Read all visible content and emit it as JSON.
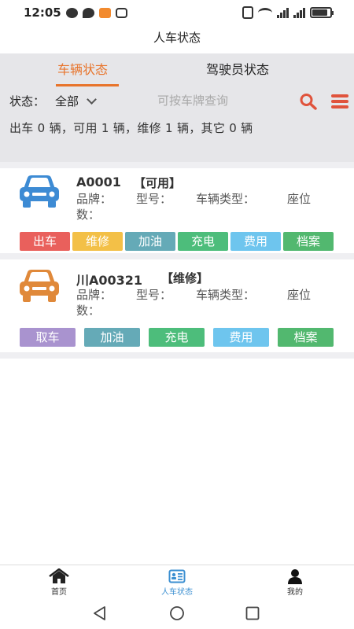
{
  "status_bar": {
    "time": "12:05"
  },
  "header": {
    "title": "人车状态"
  },
  "tabs": [
    {
      "label": "车辆状态",
      "active": true
    },
    {
      "label": "驾驶员状态",
      "active": false
    }
  ],
  "filter": {
    "status_label": "状态：",
    "status_value": "全部",
    "search_placeholder": "可按车牌查询"
  },
  "summary": "出车 0 辆，可用 1 辆，维修 1 辆，其它 0 辆",
  "vehicles": [
    {
      "plate": "A0001",
      "state": "【可用】",
      "icon_color": "#3d8bd4",
      "fields": {
        "brand": "品牌：",
        "model": "型号：",
        "type": "车辆类型：",
        "seats_a": "座位",
        "seats_b": "数："
      },
      "actions": [
        {
          "label": "出车",
          "color": "#e9605c"
        },
        {
          "label": "维修",
          "color": "#f3c047"
        },
        {
          "label": "加油",
          "color": "#65aab7"
        },
        {
          "label": "充电",
          "color": "#4dbd7b"
        },
        {
          "label": "费用",
          "color": "#6ec5ee"
        },
        {
          "label": "档案",
          "color": "#52b86f"
        }
      ]
    },
    {
      "plate": "川A00321",
      "state": "【维修】",
      "icon_color": "#e0893a",
      "fields": {
        "brand": "品牌：",
        "model": "型号：",
        "type": "车辆类型：",
        "seats_a": "座位",
        "seats_b": "数："
      },
      "actions": [
        {
          "label": "取车",
          "color": "#a993cf"
        },
        {
          "label": "加油",
          "color": "#65aab7"
        },
        {
          "label": "充电",
          "color": "#4dbd7b"
        },
        {
          "label": "费用",
          "color": "#6ec5ee"
        },
        {
          "label": "档案",
          "color": "#52b86f"
        }
      ]
    }
  ],
  "bottom_nav": [
    {
      "label": "首页",
      "icon": "home-icon",
      "active": false
    },
    {
      "label": "人车状态",
      "icon": "id-card-icon",
      "active": true
    },
    {
      "label": "我的",
      "icon": "user-icon",
      "active": false
    }
  ],
  "colors": {
    "accent": "#e8742b",
    "panel_bg": "#e6e6e9",
    "nav_active": "#3b8fd1",
    "search_icon": "#e0533c"
  }
}
